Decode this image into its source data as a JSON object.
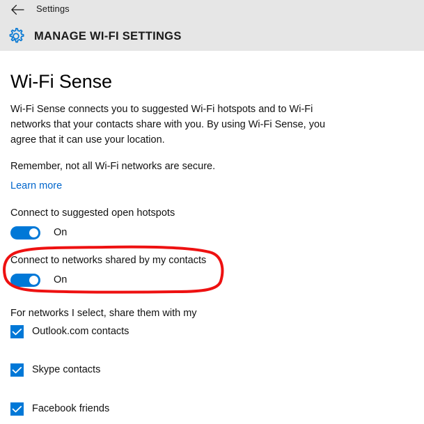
{
  "titlebar": {
    "back_icon": "back-arrow-icon",
    "app_label": "Settings",
    "gear_icon": "gear-icon",
    "page_heading": "MANAGE WI-FI SETTINGS"
  },
  "content": {
    "section_title": "Wi-Fi Sense",
    "description": "Wi-Fi Sense connects you to suggested Wi-Fi hotspots and to Wi-Fi networks that your contacts share with you. By using Wi-Fi Sense, you agree that it can use your location.",
    "remember_note": "Remember, not all Wi-Fi networks are secure.",
    "learn_more_link": "Learn more",
    "settings": [
      {
        "label": "Connect to suggested open hotspots",
        "state": "On",
        "checked": true
      },
      {
        "label": "Connect to networks shared by my contacts",
        "state": "On",
        "checked": true
      }
    ],
    "share_label": "For networks I select, share them with my",
    "checkboxes": [
      {
        "label": "Outlook.com contacts",
        "checked": true
      },
      {
        "label": "Skype contacts",
        "checked": true
      },
      {
        "label": "Facebook friends",
        "checked": true
      }
    ]
  },
  "annotation": {
    "shape": "ellipse",
    "color": "#ee1111",
    "target": "Connect to networks shared by my contacts"
  },
  "colors": {
    "accent": "#0078d7",
    "titlebar_bg": "#e6e6e6",
    "link": "#0066cc",
    "annotation_red": "#ee1111",
    "page_bg": "#ffffff",
    "text": "#111111"
  }
}
